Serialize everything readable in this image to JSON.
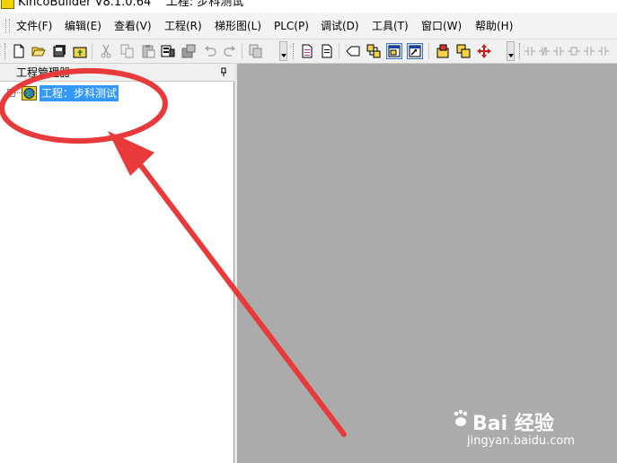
{
  "window": {
    "title": "KincoBuilder V8.1.0.64    工程: 步科测试"
  },
  "menubar": {
    "items": [
      {
        "label": "文件(F)"
      },
      {
        "label": "编辑(E)"
      },
      {
        "label": "查看(V)"
      },
      {
        "label": "工程(R)"
      },
      {
        "label": "梯形图(L)"
      },
      {
        "label": "PLC(P)"
      },
      {
        "label": "调试(D)"
      },
      {
        "label": "工具(T)"
      },
      {
        "label": "窗口(W)"
      },
      {
        "label": "帮助(H)"
      }
    ]
  },
  "toolbar": {
    "icons": [
      "new-file-icon",
      "open-folder-icon",
      "save-all-icon",
      "upload-icon",
      "cut-icon",
      "copy-icon",
      "paste-icon",
      "download-icon",
      "compile-icon",
      "undo-icon",
      "redo-icon",
      "find-icon",
      "document-icon",
      "page-icon",
      "arrow-tag-icon",
      "network-icon",
      "monitor-icon",
      "status-chart-icon",
      "wizard-icon",
      "library-icon",
      "move-icon",
      "contact-icon"
    ]
  },
  "project_panel": {
    "title": "工程管理器",
    "root_node": {
      "label": "工程：步科测试"
    }
  },
  "watermark": {
    "logo": "Bai 经验",
    "url": "jingyan.baidu.com"
  },
  "colors": {
    "selection": "#3399ff",
    "workspace": "#ababab",
    "annotation": "#e83a3a"
  }
}
